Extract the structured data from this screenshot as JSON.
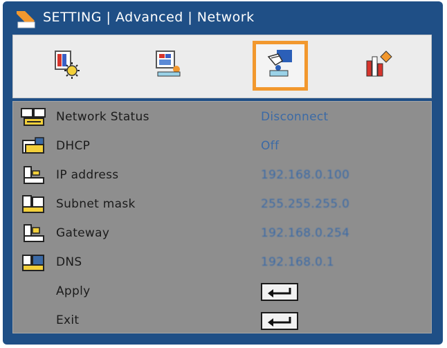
{
  "menu": {
    "title": "SETTING | Advanced | Network"
  },
  "tabs": [
    {
      "name": "Image",
      "icon": "image-tab-icon",
      "selected": false
    },
    {
      "name": "Display",
      "icon": "display-tab-icon",
      "selected": false
    },
    {
      "name": "Setting",
      "icon": "setting-tab-icon",
      "selected": true
    },
    {
      "name": "Options",
      "icon": "options-tab-icon",
      "selected": false
    }
  ],
  "items": [
    {
      "label": "Network Status",
      "value": "Disconnect",
      "icon": "network-status-icon"
    },
    {
      "label": "DHCP",
      "value": "Off",
      "icon": "dhcp-icon"
    },
    {
      "label": "IP address",
      "value": "192.168.0.100",
      "icon": "ip-address-icon"
    },
    {
      "label": "Subnet mask",
      "value": "255.255.255.0",
      "icon": "subnet-mask-icon"
    },
    {
      "label": "Gateway",
      "value": "192.168.0.254",
      "icon": "gateway-icon"
    },
    {
      "label": "DNS",
      "value": "192.168.0.1",
      "icon": "dns-icon"
    },
    {
      "label": "Apply",
      "icon": "enter-icon"
    },
    {
      "label": "Exit",
      "icon": "enter-icon"
    }
  ],
  "colors": {
    "frame": "#1f4f86",
    "highlight": "#f2982e",
    "value_text": "#3b6aa6"
  }
}
